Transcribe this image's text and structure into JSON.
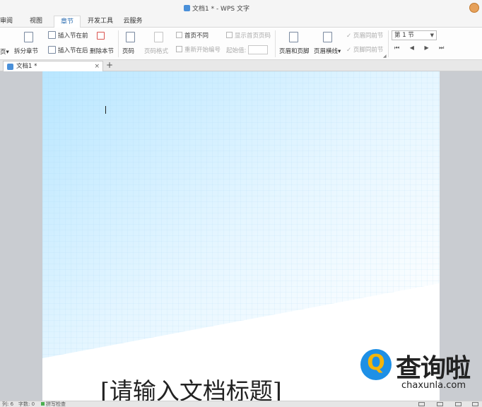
{
  "window": {
    "title": "文档1 * - WPS 文字"
  },
  "menu_tabs": [
    {
      "label": "审阅",
      "active": false
    },
    {
      "label": "视图",
      "active": false
    },
    {
      "label": "章节",
      "active": true
    },
    {
      "label": "开发工具",
      "active": false
    },
    {
      "label": "云服务",
      "active": false
    }
  ],
  "ribbon": {
    "split_section": "拆分章节",
    "insert_section_before": "插入节在前",
    "insert_section_after": "插入节在后",
    "delete_section": "删除本节",
    "page_number": "页码",
    "page_number_format": "页码格式",
    "diff_first_page": "首页不同",
    "restart_numbering": "重新开始编号",
    "show_first_page_number": "显示首页页码",
    "start_value_label": "起始值:",
    "header_footer": "页眉和页脚",
    "header_line": "页眉横线",
    "header_same_as_prev": "页眉同前节",
    "footer_same_as_prev": "页脚同前节",
    "section_select": "第 1 节",
    "section_nav": "⏮ ◀ ▶ ⏭"
  },
  "doc_tab": {
    "label": "文档1 *",
    "close": "×",
    "new_tab": "+"
  },
  "document": {
    "title_placeholder": "[请输入文档标题]"
  },
  "watermark": {
    "q_letter": "Q",
    "brand_cn": "查询啦",
    "brand_url": "chaxunla.com"
  },
  "statusbar": {
    "column": "列: 6",
    "word_count": "字数: 0",
    "spell_check": "拼写检查"
  },
  "colors": {
    "accent": "#2b6cb0",
    "page_gradient": "#bfeaff",
    "brand_blue": "#1e90e6",
    "brand_yellow": "#f5b50a"
  }
}
